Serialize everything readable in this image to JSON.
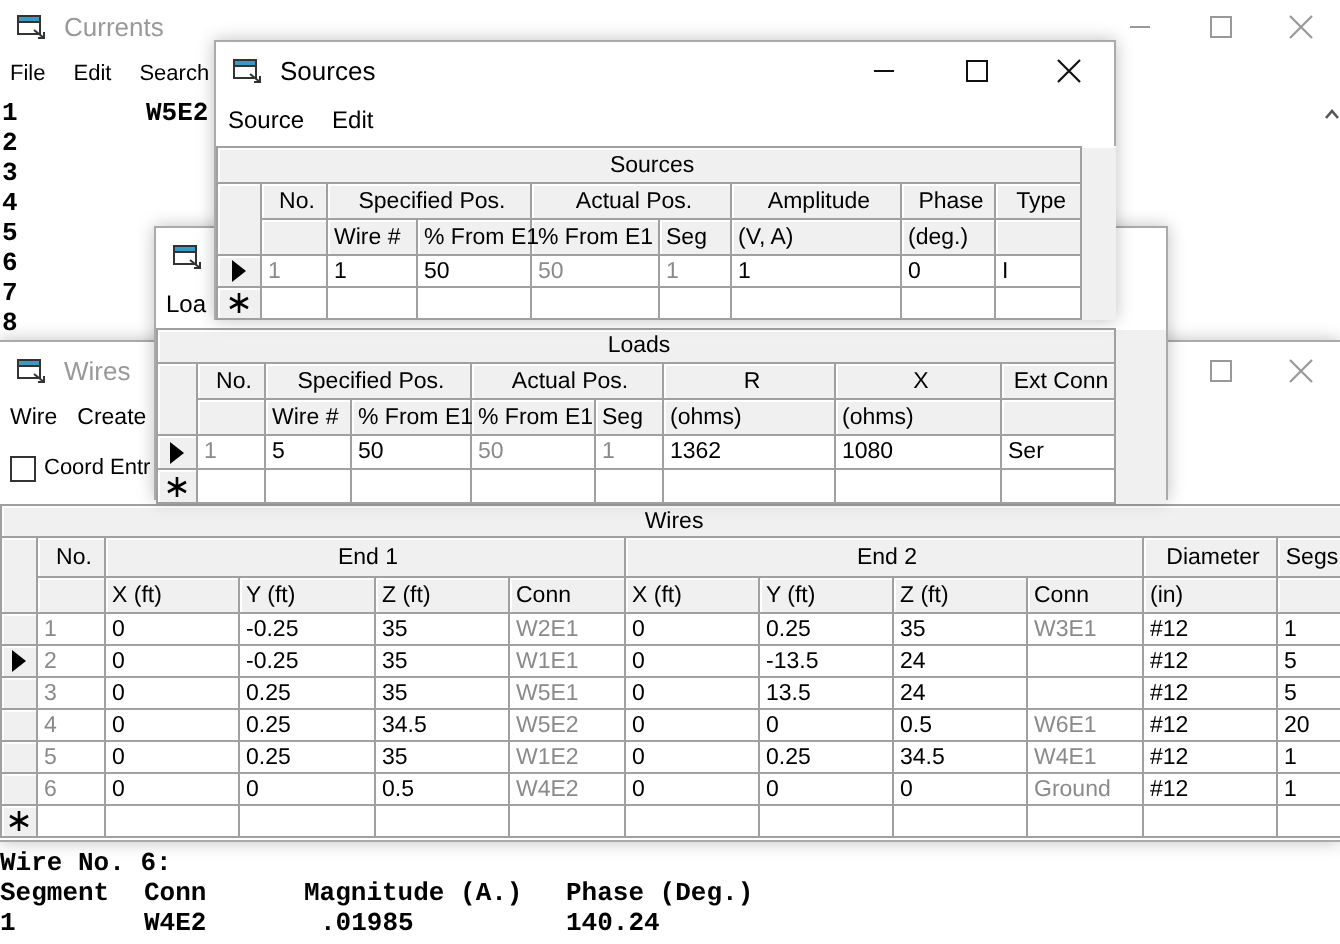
{
  "currents": {
    "title": "Currents",
    "active": false,
    "controls": [
      {
        "kind": "minimize"
      },
      {
        "kind": "maximize"
      },
      {
        "kind": "close"
      }
    ],
    "menu": [
      "File",
      "Edit",
      "Search"
    ],
    "lines": [
      {
        "number": "1",
        "conn": "W5E2"
      },
      {
        "number": "2"
      },
      {
        "number": "3"
      },
      {
        "number": "4"
      },
      {
        "number": "5"
      },
      {
        "number": "6"
      },
      {
        "number": "7"
      },
      {
        "number": "8"
      }
    ],
    "output": {
      "heading": "Wire No. 6:",
      "columns": [
        "Segment",
        "Conn",
        "Magnitude (A.)",
        "Phase (Deg.)"
      ],
      "values": [
        "1",
        "W4E2",
        ".01985",
        "140.24"
      ]
    }
  },
  "sources": {
    "title": "Sources",
    "active": true,
    "controls": [
      {
        "kind": "minimize"
      },
      {
        "kind": "maximize"
      },
      {
        "kind": "close"
      }
    ],
    "menu": [
      "Source",
      "Edit"
    ],
    "table": {
      "caption": "Sources",
      "new_row": true,
      "groups": [
        {
          "label": "No.",
          "columns": [
            {
              "derived": true
            }
          ]
        },
        {
          "label": "Specified Pos.",
          "columns": [
            {
              "label": "Wire #",
              "derived": false
            },
            {
              "label": "% From E1",
              "derived": false
            }
          ]
        },
        {
          "label": "Actual Pos.",
          "columns": [
            {
              "label": "% From E1",
              "derived": true
            },
            {
              "label": "Seg",
              "derived": true
            }
          ]
        },
        {
          "label": "Amplitude",
          "columns": [
            {
              "label": "(V, A)",
              "derived": false
            }
          ]
        },
        {
          "label": "Phase",
          "columns": [
            {
              "label": "(deg.)",
              "derived": false
            }
          ]
        },
        {
          "label": "Type",
          "columns": [
            {
              "derived": false
            }
          ]
        }
      ],
      "rows": [
        {
          "current": true,
          "cells": [
            "1",
            "1",
            "50",
            "50",
            "1",
            "1",
            "0",
            "I"
          ]
        }
      ]
    }
  },
  "loads": {
    "menu": [
      "Loa"
    ],
    "table": {
      "caption": "Loads",
      "new_row": true,
      "groups": [
        {
          "label": "No.",
          "columns": [
            {
              "derived": true
            }
          ]
        },
        {
          "label": "Specified Pos.",
          "columns": [
            {
              "label": "Wire #",
              "derived": false
            },
            {
              "label": "% From E1",
              "derived": false
            }
          ]
        },
        {
          "label": "Actual Pos.",
          "columns": [
            {
              "label": "% From E1",
              "derived": true
            },
            {
              "label": "Seg",
              "derived": true
            }
          ]
        },
        {
          "label": "R",
          "columns": [
            {
              "label": "(ohms)",
              "derived": false
            }
          ]
        },
        {
          "label": "X",
          "columns": [
            {
              "label": "(ohms)",
              "derived": false
            }
          ]
        },
        {
          "label": "Ext Conn",
          "columns": [
            {
              "derived": false
            }
          ]
        }
      ],
      "rows": [
        {
          "current": true,
          "cells": [
            "1",
            "5",
            "50",
            "50",
            "1",
            "1362",
            "1080",
            "Ser"
          ]
        }
      ]
    }
  },
  "wires": {
    "title": "Wires",
    "active": false,
    "controls": [
      {
        "kind": "maximize"
      },
      {
        "kind": "close"
      }
    ],
    "menu": [
      "Wire",
      "Create"
    ],
    "coord_entry": {
      "label": "Coord Entr",
      "checked": false
    },
    "table": {
      "caption": "Wires",
      "new_row": true,
      "groups": [
        {
          "label": "No.",
          "columns": [
            {
              "derived": true
            }
          ]
        },
        {
          "label": "End 1",
          "columns": [
            {
              "label": "X (ft)",
              "derived": false
            },
            {
              "label": "Y (ft)",
              "derived": false
            },
            {
              "label": "Z (ft)",
              "derived": false
            },
            {
              "label": "Conn",
              "derived": true
            }
          ]
        },
        {
          "label": "End 2",
          "columns": [
            {
              "label": "X (ft)",
              "derived": false
            },
            {
              "label": "Y (ft)",
              "derived": false
            },
            {
              "label": "Z (ft)",
              "derived": false
            },
            {
              "label": "Conn",
              "derived": true
            }
          ]
        },
        {
          "label": "Diameter",
          "columns": [
            {
              "label": "(in)",
              "derived": false
            }
          ]
        },
        {
          "label": "Segs",
          "columns": [
            {
              "derived": false
            }
          ]
        }
      ],
      "rows": [
        {
          "current": false,
          "cells": [
            "1",
            "0",
            "-0.25",
            "35",
            "W2E1",
            "0",
            "0.25",
            "35",
            "W3E1",
            "#12",
            "1"
          ]
        },
        {
          "current": true,
          "cells": [
            "2",
            "0",
            "-0.25",
            "35",
            "W1E1",
            "0",
            "-13.5",
            "24",
            null,
            "#12",
            "5"
          ]
        },
        {
          "current": false,
          "cells": [
            "3",
            "0",
            "0.25",
            "35",
            "W5E1",
            "0",
            "13.5",
            "24",
            null,
            "#12",
            "5"
          ]
        },
        {
          "current": false,
          "cells": [
            "4",
            "0",
            "0.25",
            "34.5",
            "W5E2",
            "0",
            "0",
            "0.5",
            "W6E1",
            "#12",
            "20"
          ]
        },
        {
          "current": false,
          "cells": [
            "5",
            "0",
            "0.25",
            "35",
            "W1E2",
            "0",
            "0.25",
            "34.5",
            "W4E1",
            "#12",
            "1"
          ]
        },
        {
          "current": false,
          "cells": [
            "6",
            "0",
            "0",
            "0.5",
            "W4E2",
            "0",
            "0",
            "0",
            "Ground",
            "#12",
            "1"
          ]
        }
      ]
    }
  }
}
